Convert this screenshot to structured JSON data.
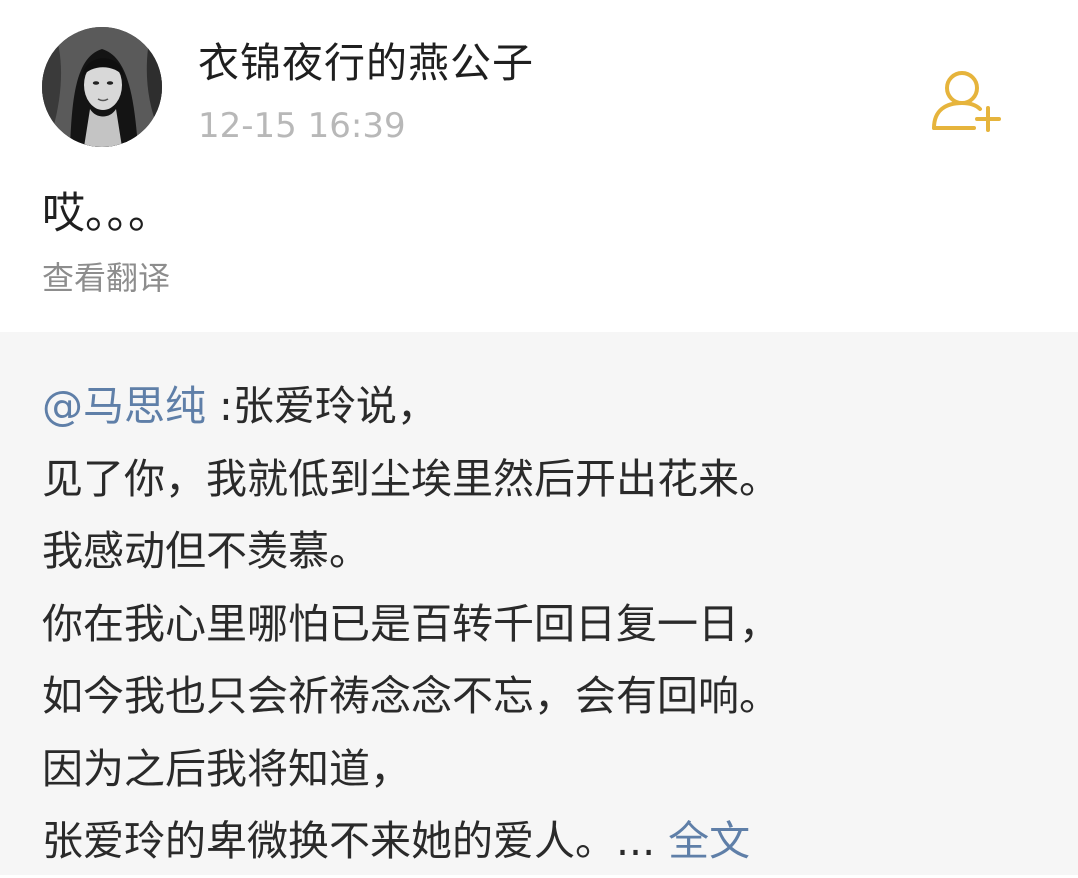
{
  "post": {
    "username": "衣锦夜行的燕公子",
    "timestamp": "12-15 16:39",
    "text": "哎。。。",
    "translate_label": "查看翻译",
    "follow_icon": "add-user-icon"
  },
  "repost": {
    "mention": "@马思纯",
    "first_line_text": " :张爱玲说，",
    "lines": [
      "见了你，我就低到尘埃里然后开出花来。",
      "我感动但不羡慕。",
      "你在我心里哪怕已是百转千回日复一日，",
      "如今我也只会祈祷念念不忘，会有回响。",
      "因为之后我将知道，"
    ],
    "last_line_text": "张爱玲的卑微换不来她的爱人。... ",
    "full_text_label": "全文"
  },
  "colors": {
    "link": "#5f7fa8",
    "follow_icon": "#e6b43c",
    "timestamp": "#b8b8b8",
    "repost_background": "#f6f6f6"
  }
}
